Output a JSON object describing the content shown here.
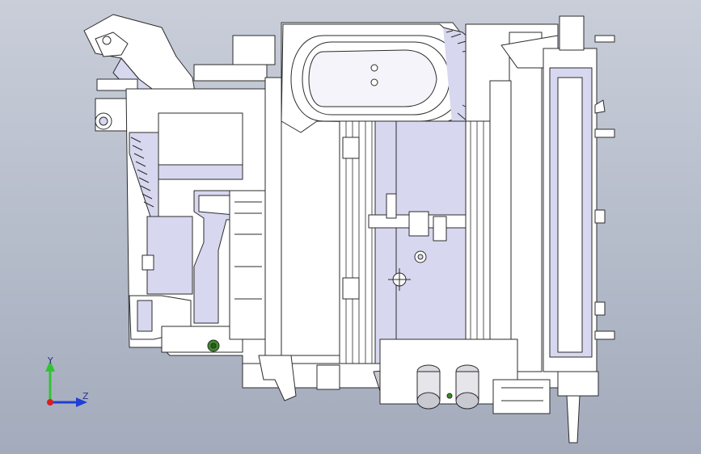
{
  "viewport": {
    "background_top": "#c9ced9",
    "background_bottom": "#a3abbc",
    "model_fill": "#ffffff",
    "model_shade": "#d7d8ef",
    "model_edge": "#2b2b2b",
    "highlight_part": "#3e8a2a"
  },
  "triad": {
    "y_label": "Y",
    "z_label": "Z",
    "y_color": "#33c233",
    "z_color": "#1f3fd6",
    "x_color": "#d62020"
  }
}
